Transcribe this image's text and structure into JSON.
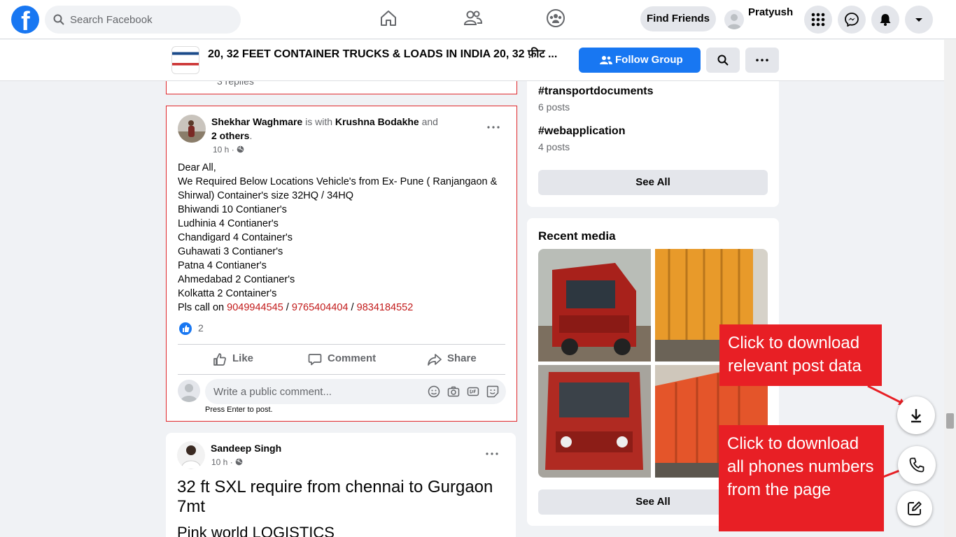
{
  "nav": {
    "logo": "f",
    "search_placeholder": "Search Facebook",
    "find_friends": "Find Friends",
    "profile_name": "Pratyush",
    "icons": [
      "home-icon",
      "friends-icon",
      "groups-icon",
      "menu-grid-icon",
      "messenger-icon",
      "notifications-icon",
      "account-caret-icon"
    ]
  },
  "group": {
    "title": "20, 32 FEET CONTAINER TRUCKS & LOADS IN INDIA 20, 32 फ़ीट ...",
    "follow_label": "Follow Group"
  },
  "prev_post": {
    "replies": "3 replies"
  },
  "post1": {
    "author": "Shekhar Waghmare",
    "with_text": " is with ",
    "tagged": "Krushna Bodakhe",
    "and_text": " and",
    "others": "2 others",
    "others_suffix": ".",
    "time": "10 h · ",
    "lines": [
      "Dear All,",
      "We Required Below Locations Vehicle's from Ex- Pune ( Ranjangaon & Shirwal) Container's size 32HQ / 34HQ",
      "Bhiwandi 10 Contianer's",
      "Ludhinia 4 Contianer's",
      "Chandigard 4 Container's",
      "Guhawati 3 Contianer's",
      "Patna 4 Contianer's",
      "Ahmedabad 2 Contianer's",
      "Kolkatta 2 Container's"
    ],
    "call_prefix": "Pls call on ",
    "phones": [
      "9049944545",
      "9765404404",
      "9834184552"
    ],
    "phone_sep": " / ",
    "like_count": "2",
    "actions": {
      "like": "Like",
      "comment": "Comment",
      "share": "Share"
    },
    "comment_placeholder": "Write a public comment...",
    "press_enter": "Press Enter to post."
  },
  "post2": {
    "author": "Sandeep Singh",
    "time": "10 h · ",
    "text": "32 ft SXL require from chennai to Gurgaon 7mt",
    "text2": "Pink world LOGISTICS"
  },
  "hashtags": [
    {
      "tag": "#transportdocuments",
      "count": "6 posts"
    },
    {
      "tag": "#webapplication",
      "count": "4 posts"
    }
  ],
  "see_all": "See All",
  "recent_media": {
    "title": "Recent media",
    "see_all": "See All"
  },
  "overlay": {
    "callout1": "Click to download relevant post data",
    "callout2": "Click to download all phones numbers from the page",
    "accent": "#e81f25"
  }
}
